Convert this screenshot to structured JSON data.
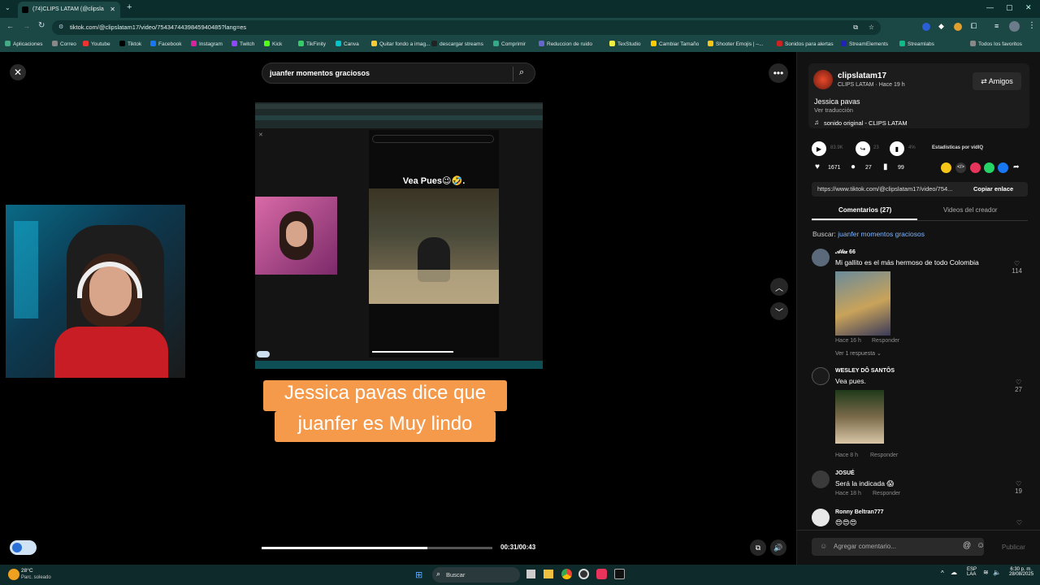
{
  "browser": {
    "tab_title": "(74)CLIPS LATAM (@clipsla",
    "url": "tiktok.com/@clipslatam17/video/7543474439845940485?lang=es",
    "bookmarks": [
      "Aplicaciones",
      "Correo",
      "Youtube",
      "Tiktok",
      "Facebook",
      "Instagram",
      "Twitch",
      "Kick",
      "TikFinity",
      "Canva",
      "Quitar fondo a imag...",
      "descargar streams",
      "Comprimir",
      "Reduccion de ruido",
      "TexStudio",
      "Cambiar Tamaño",
      "Shooter Emojis | –...",
      "Sonidos para alertas",
      "StreamElements",
      "Streamlabs",
      "Todos los favoritos"
    ],
    "colors": {
      "chrome": "#1b4745",
      "tabbar": "#0b2e2d"
    }
  },
  "player": {
    "search_value": "juanfer momentos graciosos",
    "embedded_caption": "Vea Pues😉🤣.",
    "overlay_text_line1": "Jessica pavas dice que",
    "overlay_text_line2": "juanfer es Muy lindo",
    "time": "00:31/00:43",
    "progress": 0.72,
    "overlay_color": "#f59a4a"
  },
  "post": {
    "username": "clipslatam17",
    "subline": "CLIPS LATAM · Hace 19 h",
    "friends_button": "Amigos",
    "caption": "Jessica pavas",
    "translate": "Ver traducción",
    "sound": "sonido original - CLIPS LATAM",
    "stats_views": "83.9K",
    "stats_shares": "23",
    "stats_pct": "4%",
    "stats_label": "Estadísticas por vidIQ",
    "likes": "1671",
    "comments_count": "27",
    "saves": "99",
    "link": "https://www.tiktok.com/@clipslatam17/video/754...",
    "copy_link": "Copiar enlace",
    "tab_comments": "Comentarios (27)",
    "tab_creator": "Videos del creador",
    "search_label": "Buscar:",
    "search_term": "juanfer momentos graciosos"
  },
  "comments": [
    {
      "name": "𝒜𝓁𝑒𝓍 66",
      "text": "Mi gallito es el más hermoso de todo Colombia",
      "meta": "Hace 16 h",
      "reply": "Responder",
      "likes": "114",
      "replies": "Ver 1 respuesta"
    },
    {
      "name": "WESLEY DÔ SANTÔS",
      "text": "Vea pues.",
      "meta": "Hace 8 h",
      "reply": "Responder",
      "likes": "27"
    },
    {
      "name": "JOSUÉ",
      "text": "Será la indicada 😱",
      "meta": "Hace 18 h",
      "reply": "Responder",
      "likes": "19"
    },
    {
      "name": "Ronny Beltran777",
      "text": "😍😍😍",
      "meta": "",
      "reply": "",
      "likes": ""
    }
  ],
  "composer": {
    "placeholder": "Agregar comentario...",
    "publish": "Publicar"
  },
  "taskbar": {
    "weather_temp": "28°C",
    "weather_desc": "Parc. soleado",
    "search": "Buscar",
    "lang1": "ESP",
    "lang2": "LAA",
    "time": "6:30 p. m.",
    "date": "28/08/2025"
  }
}
